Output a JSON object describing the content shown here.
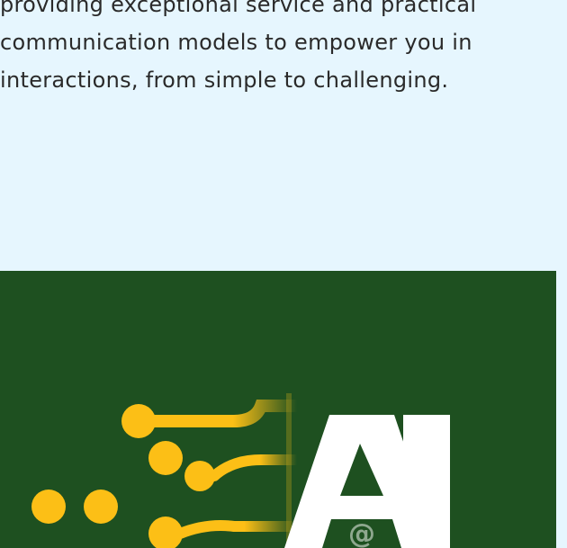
{
  "intro": {
    "lines": [
      "providing exceptional service and practical",
      "communication models to empower you in",
      "interactions, from simple to challenging."
    ]
  },
  "hero": {
    "background_color": "#1e5020",
    "accent_color": "#fcbf16",
    "logo_letters": "AI",
    "logo_symbol": "@",
    "icon": "circuit-ai-logo-icon"
  }
}
